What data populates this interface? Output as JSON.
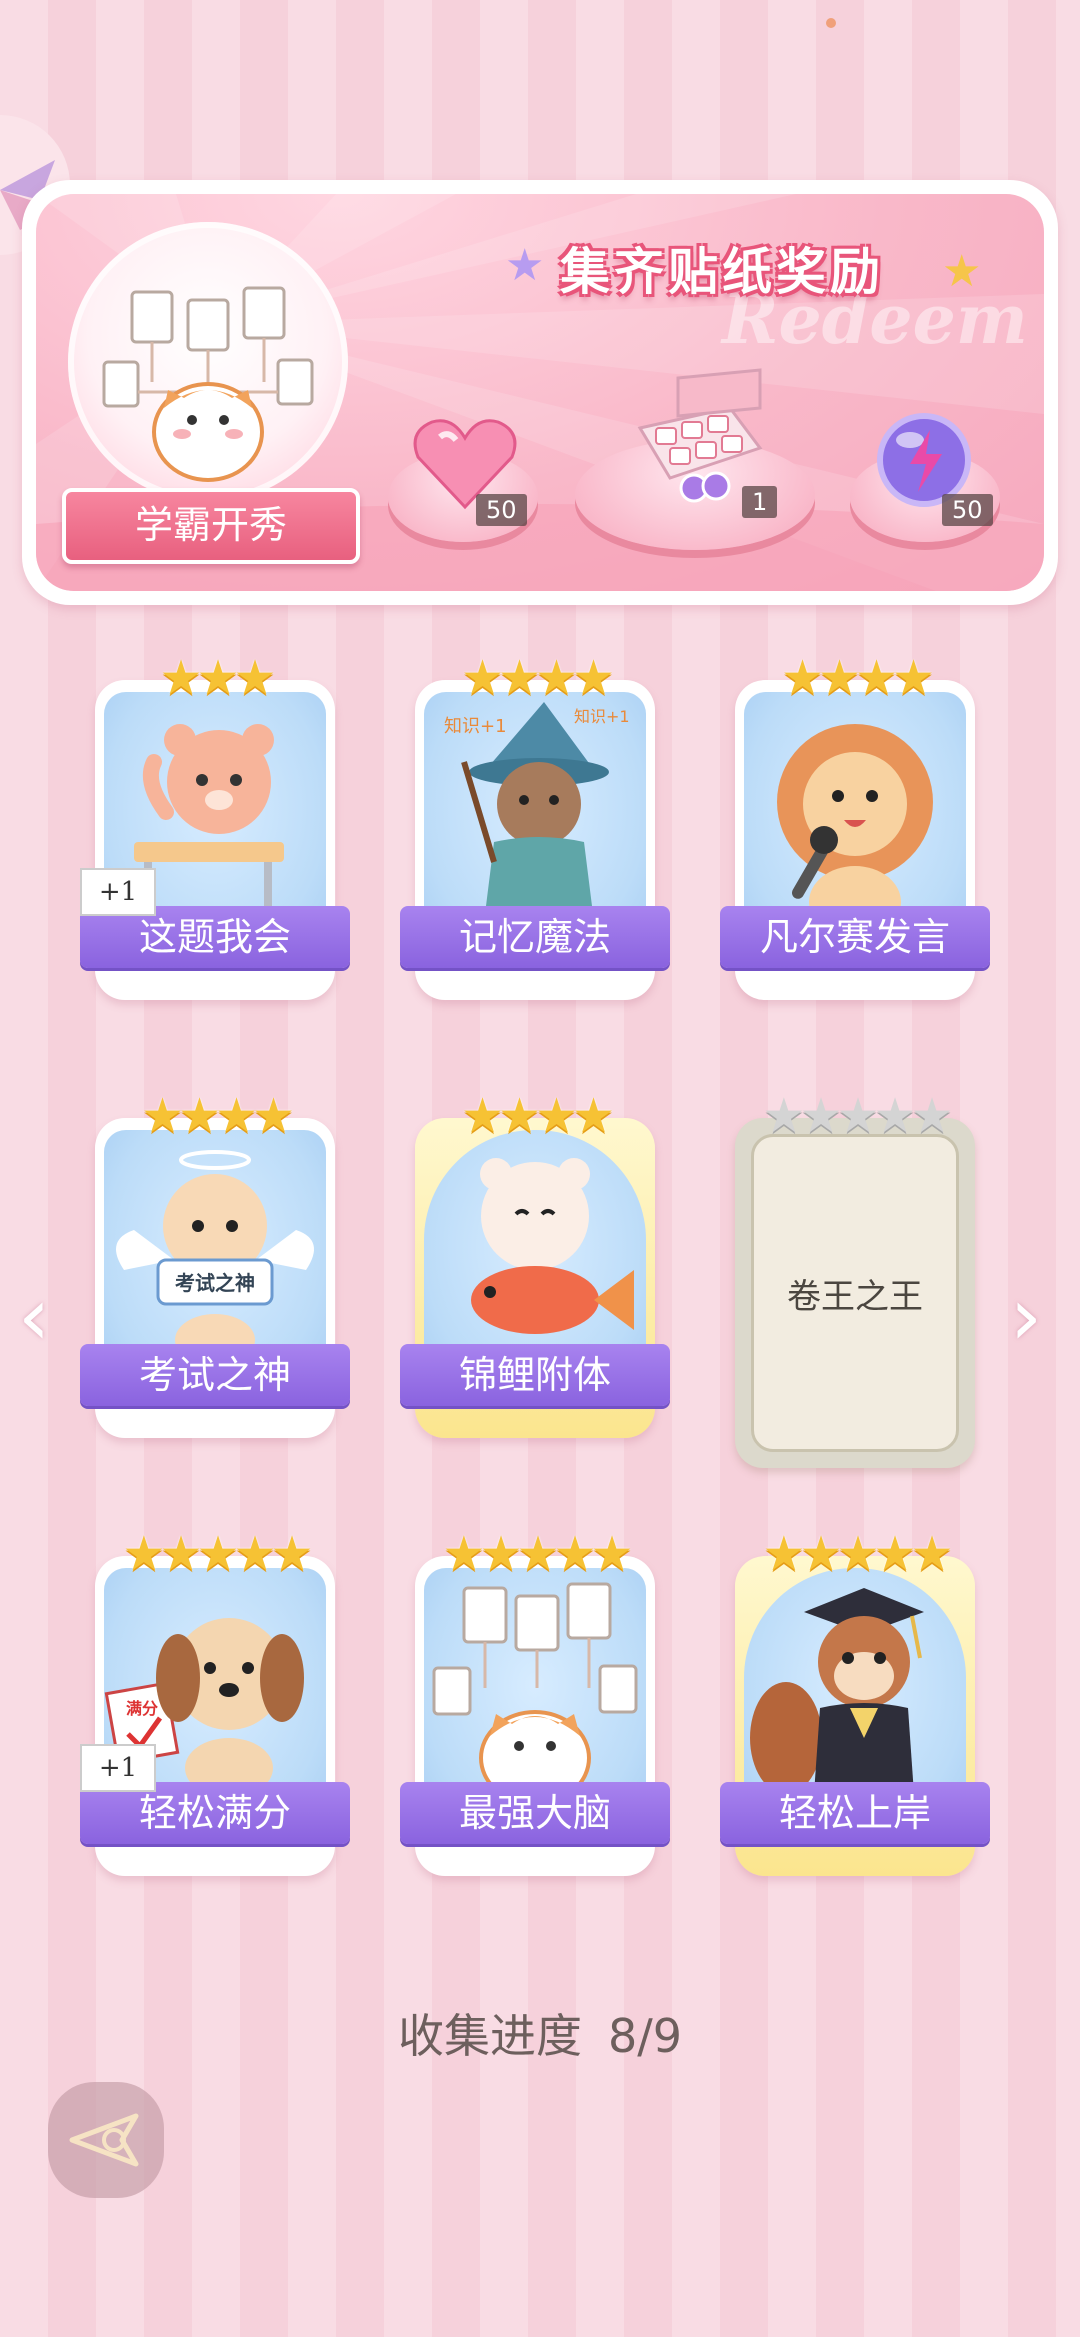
{
  "banner": {
    "title": "集齐贴纸奖励",
    "watermark": "Redeem",
    "album_label": "学霸开秀",
    "rewards": [
      {
        "icon": "heart-gem-icon",
        "count": "50"
      },
      {
        "icon": "gift-box-icon",
        "count": "1"
      },
      {
        "icon": "lightning-orb-icon",
        "count": "50"
      }
    ]
  },
  "cards": [
    {
      "label": "这题我会",
      "stars": 3,
      "plus": "+1",
      "unlocked": true,
      "gold": false,
      "art": "bear-at-desk"
    },
    {
      "label": "记忆魔法",
      "stars": 4,
      "plus": "",
      "unlocked": true,
      "gold": false,
      "art": "wizard-otter",
      "art_text": "知识+1"
    },
    {
      "label": "凡尔赛发言",
      "stars": 4,
      "plus": "",
      "unlocked": true,
      "gold": false,
      "art": "lion-with-mic"
    },
    {
      "label": "考试之神",
      "stars": 4,
      "plus": "",
      "unlocked": true,
      "gold": false,
      "art": "angel-cat",
      "art_text": "考试之神"
    },
    {
      "label": "锦鲤附体",
      "stars": 4,
      "plus": "",
      "unlocked": true,
      "gold": true,
      "art": "bear-with-koi"
    },
    {
      "label": "卷王之王",
      "stars": 5,
      "plus": "",
      "unlocked": false,
      "gold": false,
      "art": ""
    },
    {
      "label": "轻松满分",
      "stars": 5,
      "plus": "+1",
      "unlocked": true,
      "gold": false,
      "art": "puppy-full-marks",
      "art_text": "满分"
    },
    {
      "label": "最强大脑",
      "stars": 5,
      "plus": "",
      "unlocked": true,
      "gold": false,
      "art": "cat-with-papers"
    },
    {
      "label": "轻松上岸",
      "stars": 5,
      "plus": "",
      "unlocked": true,
      "gold": true,
      "art": "graduate-squirrel"
    }
  ],
  "progress": {
    "label": "收集进度",
    "value": "8/9"
  }
}
